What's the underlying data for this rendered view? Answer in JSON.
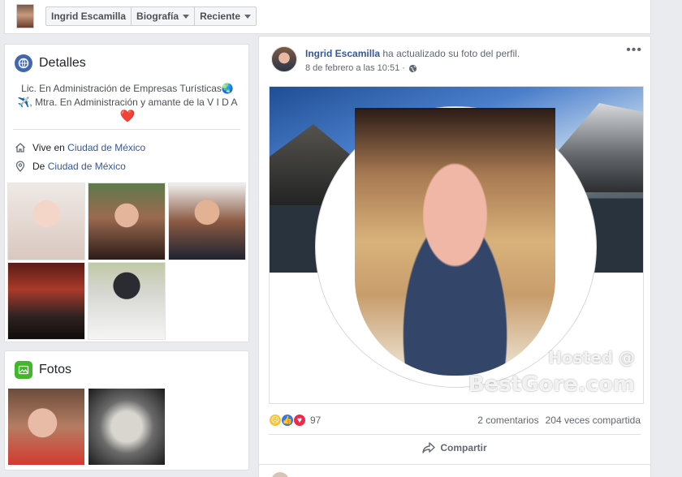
{
  "header": {
    "breadcrumbs": [
      {
        "label": "Ingrid Escamilla",
        "dropdown": false
      },
      {
        "label": "Biografía",
        "dropdown": true
      },
      {
        "label": "Reciente",
        "dropdown": true
      }
    ]
  },
  "details": {
    "title": "Detalles",
    "bio_line1": "Lic. En Administración de Empresas Turísticas🌏",
    "bio_line2": "✈️, Mtra. En Administración y amante de la V I D A",
    "bio_heart": "❤️",
    "lives_prefix": "Vive en",
    "lives_place": "Ciudad de México",
    "from_prefix": "De",
    "from_place": "Ciudad de México"
  },
  "photos_card": {
    "title": "Fotos"
  },
  "post": {
    "author": "Ingrid Escamilla",
    "action": " ha actualizado su foto del perfil.",
    "timestamp": "8 de febrero a las 10:51 ·",
    "more": "•••",
    "reaction_count": "97",
    "comments": "2 comentarios",
    "shares": "204 veces compartida",
    "share_label": "Compartir"
  },
  "watermark": {
    "line1": "Hosted @",
    "line2": "BestGore.com"
  },
  "colors": {
    "link": "#365899",
    "page_bg": "#e9ebee",
    "like_blue": "#3578e5",
    "love_red": "#f0284a",
    "sad_yellow": "#f5c33b"
  }
}
